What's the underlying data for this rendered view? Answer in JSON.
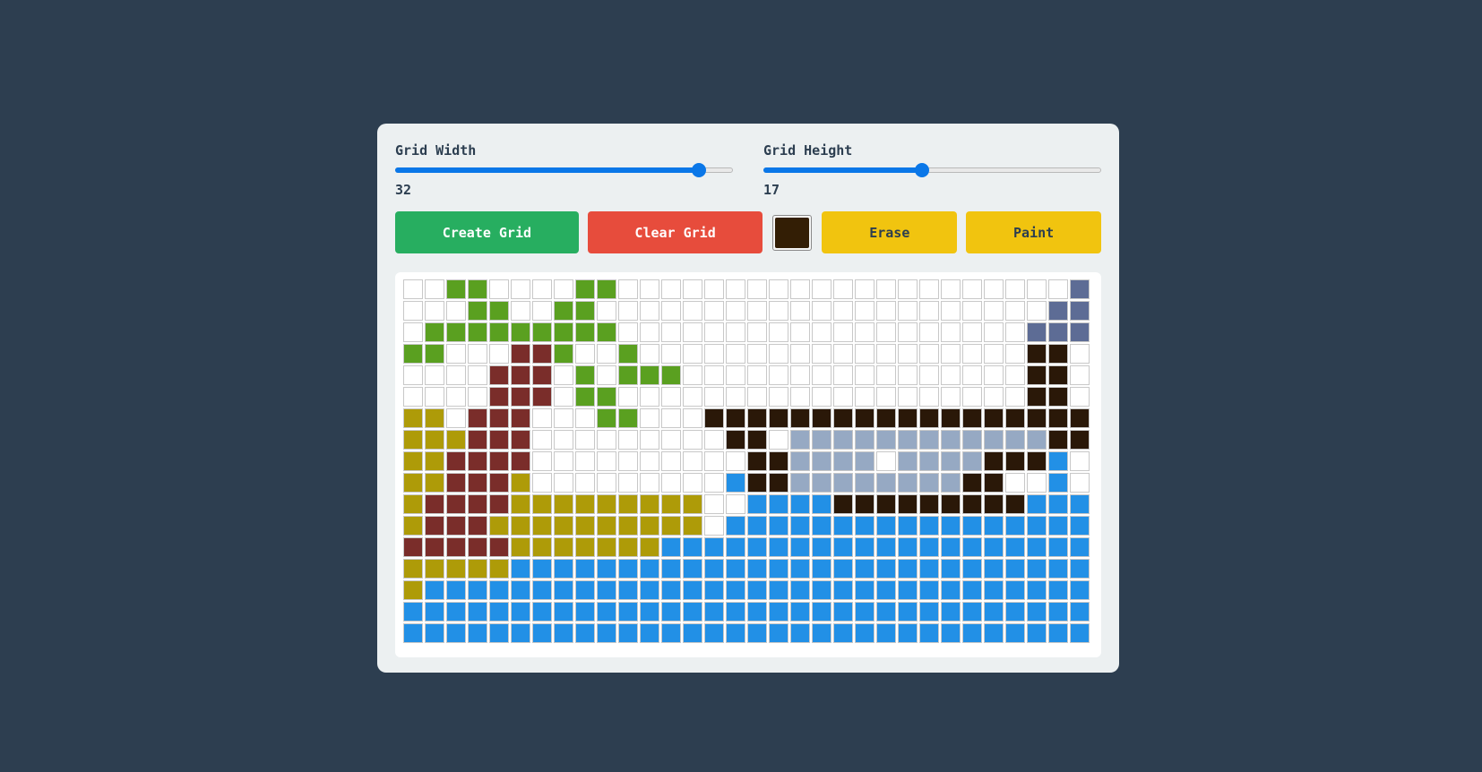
{
  "controls": {
    "width": {
      "label": "Grid Width",
      "value": "32",
      "fraction": 0.9
    },
    "height": {
      "label": "Grid Height",
      "value": "17",
      "fraction": 0.47
    }
  },
  "toolbar": {
    "create_label": "Create Grid",
    "clear_label": "Clear Grid",
    "erase_label": "Erase",
    "paint_label": "Paint",
    "current_color": "#331e05"
  },
  "grid": {
    "columns": 32,
    "rows": 17,
    "palette": {
      ".": "#ffffff",
      "G": "#5aa020",
      "R": "#7a2d2a",
      "Y": "#ae9b08",
      "D": "#2a1808",
      "S": "#96a9c3",
      "N": "#5d6c95",
      "B": "#2290e6"
    },
    "cells": [
      "..GG....GG.....................NN..",
      "...GG..GG.....................NNN..",
      ".GGGGGGGGG...................NNN...",
      "GG...RRG..G..................DD....",
      "....RRR.G.GGG................DD....",
      "....RRR.GG...................DD....",
      "YY.RRR...GG...DDDDDDDDDDDDDDDDDD",
      "YYYRRR.........DD.SSSSSSSSSSSSDD",
      "YYRRRR..........DDSSSS.SSSSDDDB",
      "YYRRRY.........BDDSSSSSSSSDD..B",
      "YRRRRYYYYYYYYY..BBBBDDDDDDDDDBBBB",
      "YRRRYYYYYYYYYY.BBBBBBBBBBBBBBBBB",
      "RRRRRYYYYYYYBBBBBBBBBBBBBBBBBBBB",
      "YYYYYBBBBBBBBBBBBBBBBBBBBBBBBBBB",
      "YBBBBBBBBBBBBBBBBBBBBBBBBBBBBBBB",
      "BBBBBBBBBBBBBBBBBBBBBBBBBBBBBBBB",
      "BBBBBBBBBBBBBBBBBBBBBBBBBBBBBBBB"
    ]
  }
}
